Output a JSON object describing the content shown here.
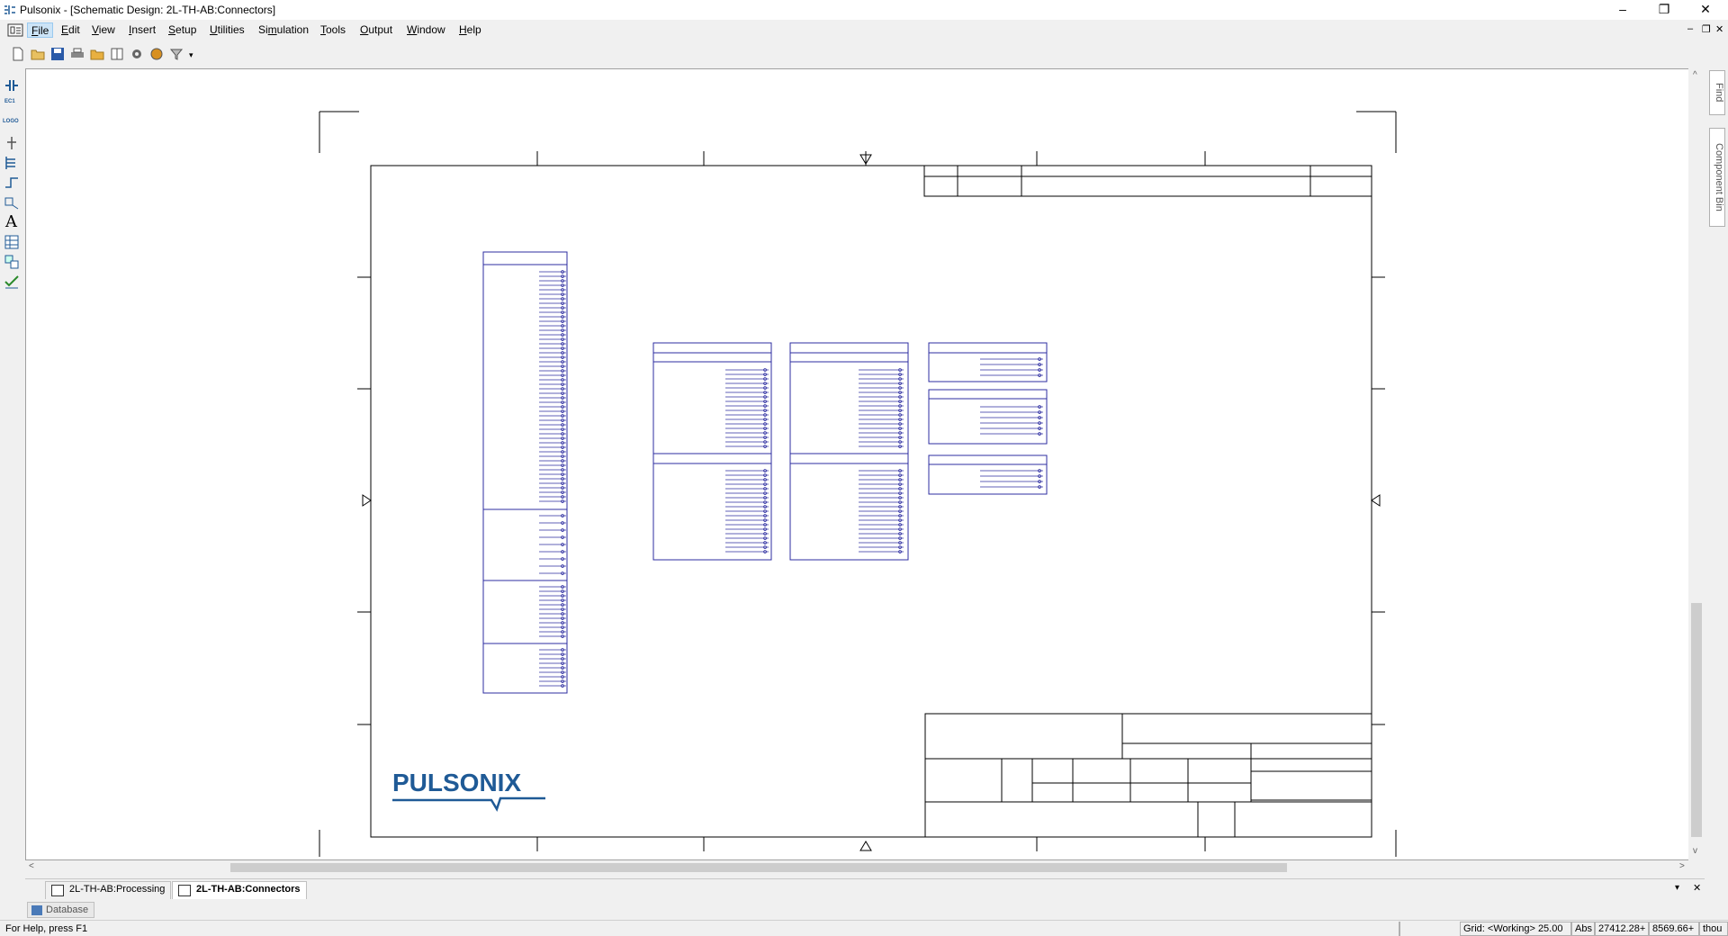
{
  "titlebar": {
    "title": "Pulsonix - [Schematic Design: 2L-TH-AB:Connectors]",
    "minimize": "–",
    "restore": "❐",
    "close": "✕"
  },
  "menu": {
    "items": [
      {
        "pre": "",
        "u": "F",
        "post": "ile"
      },
      {
        "pre": "",
        "u": "E",
        "post": "dit"
      },
      {
        "pre": "",
        "u": "V",
        "post": "iew"
      },
      {
        "pre": "",
        "u": "I",
        "post": "nsert"
      },
      {
        "pre": "",
        "u": "S",
        "post": "etup"
      },
      {
        "pre": "",
        "u": "U",
        "post": "tilities"
      },
      {
        "pre": "Si",
        "u": "m",
        "post": "ulation"
      },
      {
        "pre": "",
        "u": "T",
        "post": "ools"
      },
      {
        "pre": "",
        "u": "O",
        "post": "utput"
      },
      {
        "pre": "",
        "u": "W",
        "post": "indow"
      },
      {
        "pre": "",
        "u": "H",
        "post": "elp"
      }
    ],
    "mdi": {
      "minimize": "–",
      "restore": "❐",
      "close": "✕"
    }
  },
  "toolbar": {
    "icons": [
      "new-file-icon",
      "open-folder-icon",
      "save-icon",
      "print-icon",
      "folder-icon",
      "book-icon",
      "settings-gear-icon",
      "sphere-icon",
      "filter-icon"
    ],
    "overflow": "▾"
  },
  "left_tools": {
    "icons": [
      "capacitor-icon",
      "component-icon",
      "logo-icon",
      "pin-icon",
      "bus-icon",
      "connect-icon",
      "move-icon",
      "text-icon",
      "table-icon",
      "design-icon",
      "check-icon"
    ],
    "text_glyph": "A",
    "label_ec": "EC1",
    "label_logo": "LOGO"
  },
  "right_panel": {
    "find": "Find",
    "component_bin": "Component Bin"
  },
  "drawing": {
    "logo_text": "PULSONIX",
    "colors": {
      "frame": "#000000",
      "symbol": "#2c2ca0",
      "logo": "#1f5a96"
    }
  },
  "scroll": {
    "left": "<",
    "right": ">",
    "up": "^",
    "down": "v"
  },
  "doc_tabs": {
    "tabs": [
      {
        "label": "2L-TH-AB:Processing"
      },
      {
        "label": "2L-TH-AB:Connectors"
      }
    ],
    "dropdown": "▾",
    "close": "✕"
  },
  "database_tab": {
    "label": "Database"
  },
  "status": {
    "help": "For Help, press F1",
    "grid": "Grid: <Working> 25.00",
    "mode": "Abs",
    "x": "27412.28+",
    "y": "8569.66+",
    "units": "thou"
  }
}
